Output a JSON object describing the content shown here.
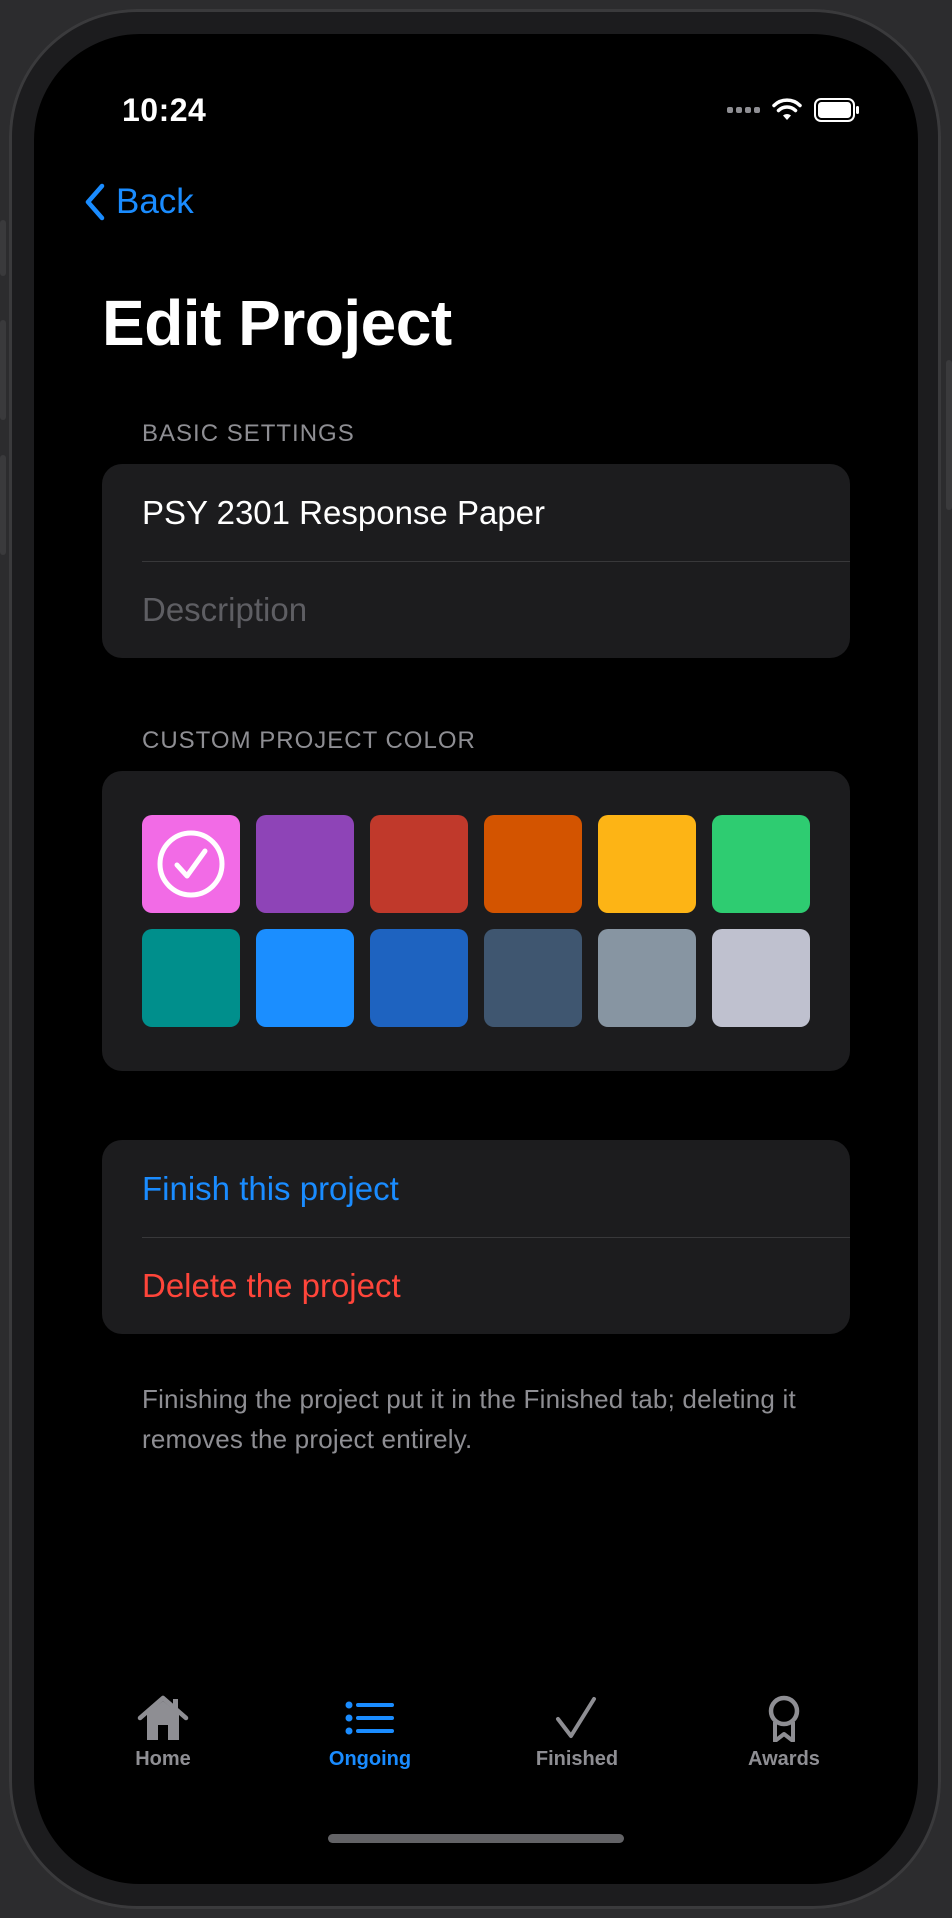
{
  "status_bar": {
    "time": "10:24"
  },
  "nav": {
    "back_label": "Back",
    "title": "Edit Project"
  },
  "basic_settings": {
    "header": "BASIC SETTINGS",
    "name_value": "PSY 2301 Response Paper",
    "description_placeholder": "Description"
  },
  "color_section": {
    "header": "CUSTOM PROJECT COLOR",
    "selected_index": 0,
    "colors": [
      "#f26be6",
      "#8e44b7",
      "#c0392b",
      "#d35400",
      "#fdb415",
      "#2ecc71",
      "#008f8c",
      "#1b8eff",
      "#1e63c0",
      "#3f5670",
      "#8795a2",
      "#bfc1cf"
    ]
  },
  "actions": {
    "finish_label": "Finish this project",
    "delete_label": "Delete the project",
    "footnote": "Finishing the project put it in the Finished tab; deleting it removes the project entirely."
  },
  "tabs": [
    {
      "label": "Home",
      "icon": "house-icon"
    },
    {
      "label": "Ongoing",
      "icon": "list-icon",
      "active": true
    },
    {
      "label": "Finished",
      "icon": "checkmark-icon"
    },
    {
      "label": "Awards",
      "icon": "rosette-icon"
    }
  ],
  "theme": {
    "accent": "#1a8cff",
    "destructive": "#ff453a",
    "inactive_tab": "#8e8e93"
  }
}
